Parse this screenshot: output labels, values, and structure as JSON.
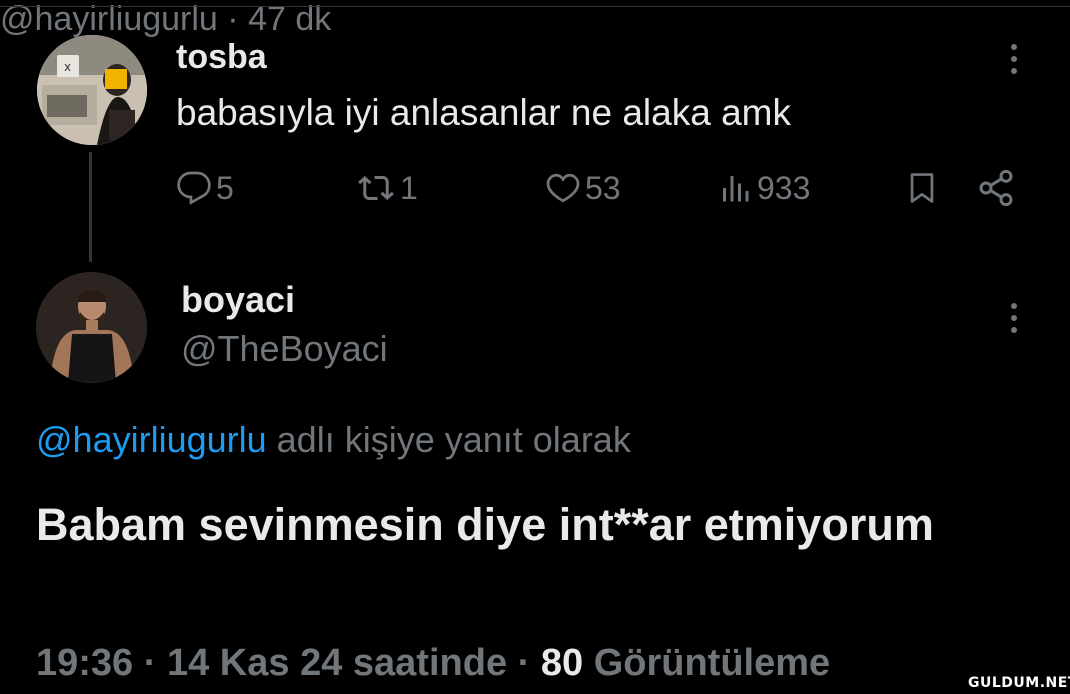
{
  "parent_tweet": {
    "display_name": "tosba",
    "handle": "@hayirliugurlu",
    "separator": "·",
    "time_ago": "47 dk",
    "text": "babasıyla iyi anlasanlar ne alaka amk",
    "avatar": "avatar",
    "actions": {
      "replies": "5",
      "retweets": "1",
      "likes": "53",
      "views": "933",
      "bookmark_icon": "bookmark-icon",
      "share_icon": "share-icon"
    }
  },
  "reply_tweet": {
    "display_name": "boyaci",
    "handle": "@TheBoyaci",
    "avatar": "avatar",
    "reply_to_mention": "@hayirliugurlu",
    "reply_to_suffix": " adlı kişiye yanıt olarak",
    "text": "Babam sevinmesin diye int**ar etmiyorum",
    "time": "19:36",
    "date": "14 Kas 24 saatinde",
    "separator": "·",
    "view_count": "80",
    "view_label": "Görüntüleme"
  },
  "watermark": "GULDUM.NET",
  "colors": {
    "background": "#000000",
    "primary_text": "#e7e9ea",
    "secondary_text": "#71767b",
    "link": "#1d9bf0"
  }
}
